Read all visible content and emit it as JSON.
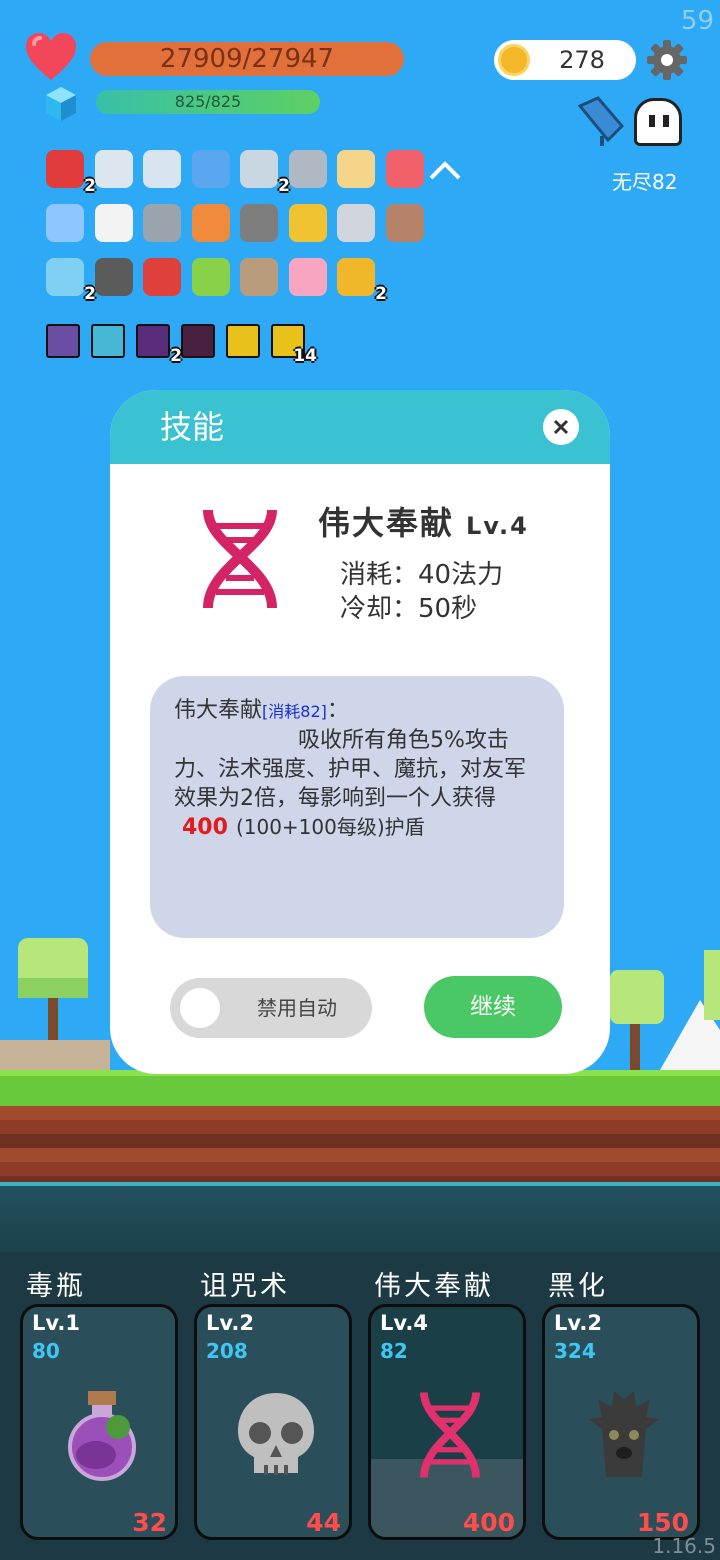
{
  "fps": "59",
  "version": "1.16.5",
  "status": {
    "hp": "27909/27947",
    "mp": "825/825",
    "mp_fraction": 1.0,
    "coins": "278",
    "mode": "无尽82"
  },
  "items": [
    {
      "name": "apple-item-icon",
      "color": "#e23b3b",
      "count": "2"
    },
    {
      "name": "hook-item-icon",
      "color": "#dce6ee",
      "count": ""
    },
    {
      "name": "sword-item-icon",
      "color": "#d8e4ef",
      "count": ""
    },
    {
      "name": "star-card-item-icon",
      "color": "#5aa7f0",
      "count": ""
    },
    {
      "name": "broadsword-item-icon",
      "color": "#c9d7e3",
      "count": "2"
    },
    {
      "name": "battle-axe-item-icon",
      "color": "#aeb9c4",
      "count": ""
    },
    {
      "name": "treasure-map-item-icon",
      "color": "#f5d58a",
      "count": ""
    },
    {
      "name": "capsule-item-icon",
      "color": "#f0616a",
      "count": ""
    },
    {
      "name": "pill-item-icon",
      "color": "#8ec6ff",
      "count": ""
    },
    {
      "name": "checklist-item-icon",
      "color": "#f3f3f3",
      "count": ""
    },
    {
      "name": "mace-item-icon",
      "color": "#9aa4ad",
      "count": ""
    },
    {
      "name": "torch-item-icon",
      "color": "#f08a3c",
      "count": ""
    },
    {
      "name": "helmet-item-icon",
      "color": "#7d7d7d",
      "count": ""
    },
    {
      "name": "ring-item-icon",
      "color": "#f1c232",
      "count": ""
    },
    {
      "name": "compass-item-icon",
      "color": "#d0d6dc",
      "count": ""
    },
    {
      "name": "mushroom-brown-item-icon",
      "color": "#b5836a",
      "count": ""
    },
    {
      "name": "potion-flask-item-icon",
      "color": "#7fd0f3",
      "count": "2"
    },
    {
      "name": "cauldron-item-icon",
      "color": "#5b5b5b",
      "count": ""
    },
    {
      "name": "mushroom-red-item-icon",
      "color": "#e0403c",
      "count": ""
    },
    {
      "name": "lime-item-icon",
      "color": "#8ad14a",
      "count": ""
    },
    {
      "name": "meteor-item-icon",
      "color": "#b99b7d",
      "count": ""
    },
    {
      "name": "ice-cream-item-icon",
      "color": "#f7a6c2",
      "count": ""
    },
    {
      "name": "coin-stack-item-icon",
      "color": "#f1b72a",
      "count": "2"
    }
  ],
  "buffs": [
    {
      "name": "blade-buff-icon",
      "color": "#6a4ea3",
      "count": ""
    },
    {
      "name": "light-buff-icon",
      "color": "#46b8d6",
      "count": ""
    },
    {
      "name": "demon-buff-icon",
      "color": "#5a2d7a",
      "count": "2"
    },
    {
      "name": "shadow-buff-icon",
      "color": "#4a2040",
      "count": ""
    },
    {
      "name": "yellow-face-buff-icon",
      "color": "#e8c21a",
      "count": ""
    },
    {
      "name": "yellow-face-buff-icon-2",
      "color": "#e8c21a",
      "count": "14"
    }
  ],
  "modal": {
    "title": "技能",
    "skill_name": "伟大奉献",
    "level": "Lv.4",
    "cost_line": "消耗：40法力",
    "cooldown_line": "冷却：50秒",
    "desc_head": "伟大奉献",
    "desc_cost": "[消耗82]",
    "desc_colon": "：",
    "desc_body": "吸收所有角色5%攻击力、法术强度、护甲、魔抗，对友军效果为2倍，每影响到一个人获得",
    "desc_value": "400",
    "desc_formula": "(100+100每级)护盾",
    "toggle_label": "禁用自动",
    "continue_label": "继续"
  },
  "skills": [
    {
      "name": "毒瓶",
      "level": "Lv.1",
      "mana": "80",
      "damage": "32",
      "icon": "poison-bottle-icon"
    },
    {
      "name": "诅咒术",
      "level": "Lv.2",
      "mana": "208",
      "damage": "44",
      "icon": "skull-icon"
    },
    {
      "name": "伟大奉献",
      "level": "Lv.4",
      "mana": "82",
      "damage": "400",
      "icon": "dna-icon"
    },
    {
      "name": "黑化",
      "level": "Lv.2",
      "mana": "324",
      "damage": "150",
      "icon": "dark-tree-icon"
    }
  ]
}
